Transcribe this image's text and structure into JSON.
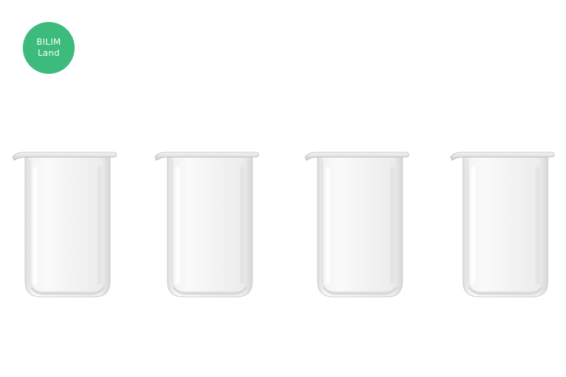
{
  "logo": {
    "line1": "BILIM",
    "line2": "Land",
    "color": "#3dbb7c"
  },
  "beakers": [
    {
      "id": 1,
      "contents": "empty"
    },
    {
      "id": 2,
      "contents": "empty"
    },
    {
      "id": 3,
      "contents": "empty"
    },
    {
      "id": 4,
      "contents": "empty"
    }
  ]
}
